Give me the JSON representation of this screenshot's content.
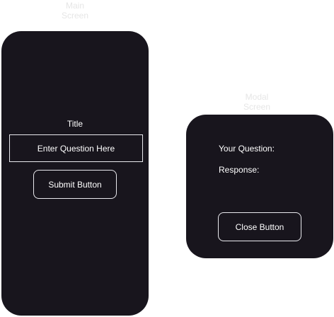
{
  "labels": {
    "main_screen": "Main\nScreen",
    "modal_screen": "Modal\nScreen"
  },
  "main": {
    "title": "Title",
    "question_placeholder": "Enter Question Here",
    "submit_label": "Submit Button"
  },
  "modal": {
    "your_question": "Your Question:",
    "response": "Response:",
    "close_label": "Close Button"
  },
  "colors": {
    "screen_bg": "#18151d",
    "outline": "#e9e9ee",
    "text": "#ffffff",
    "screen_label": "#e6e6e6"
  }
}
